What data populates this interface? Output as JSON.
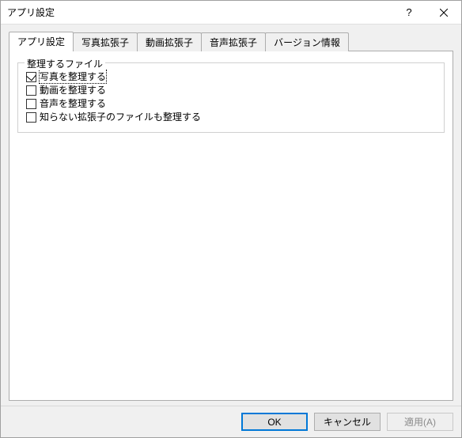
{
  "window": {
    "title": "アプリ設定"
  },
  "tabs": [
    {
      "label": "アプリ設定",
      "active": true
    },
    {
      "label": "写真拡張子",
      "active": false
    },
    {
      "label": "動画拡張子",
      "active": false
    },
    {
      "label": "音声拡張子",
      "active": false
    },
    {
      "label": "バージョン情報",
      "active": false
    }
  ],
  "group": {
    "legend": "整理するファイル",
    "items": [
      {
        "label": "写真を整理する",
        "checked": true,
        "focused": true
      },
      {
        "label": "動画を整理する",
        "checked": false,
        "focused": false
      },
      {
        "label": "音声を整理する",
        "checked": false,
        "focused": false
      },
      {
        "label": "知らない拡張子のファイルも整理する",
        "checked": false,
        "focused": false
      }
    ]
  },
  "buttons": {
    "ok": "OK",
    "cancel": "キャンセル",
    "apply": "適用(A)",
    "apply_enabled": false
  }
}
